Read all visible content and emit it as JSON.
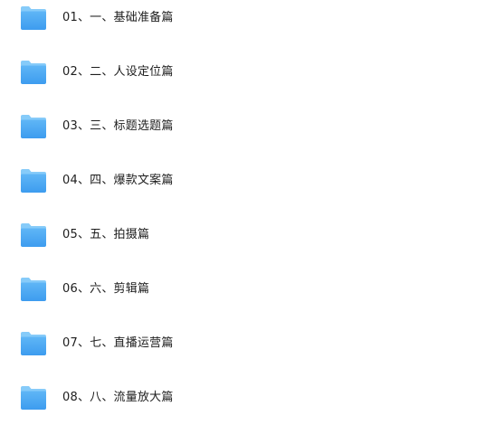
{
  "folders": [
    {
      "label": "01、一、基础准备篇",
      "icon": "folder-icon"
    },
    {
      "label": "02、二、人设定位篇",
      "icon": "folder-icon"
    },
    {
      "label": "03、三、标题选题篇",
      "icon": "folder-icon"
    },
    {
      "label": "04、四、爆款文案篇",
      "icon": "folder-icon"
    },
    {
      "label": "05、五、拍摄篇",
      "icon": "folder-icon"
    },
    {
      "label": "06、六、剪辑篇",
      "icon": "folder-icon"
    },
    {
      "label": "07、七、直播运营篇",
      "icon": "folder-icon"
    },
    {
      "label": "08、八、流量放大篇",
      "icon": "folder-icon"
    }
  ],
  "colors": {
    "folder_back": "#7cc6f8",
    "folder_front": "#4aa9f2",
    "label_text": "#1e1e1e"
  }
}
